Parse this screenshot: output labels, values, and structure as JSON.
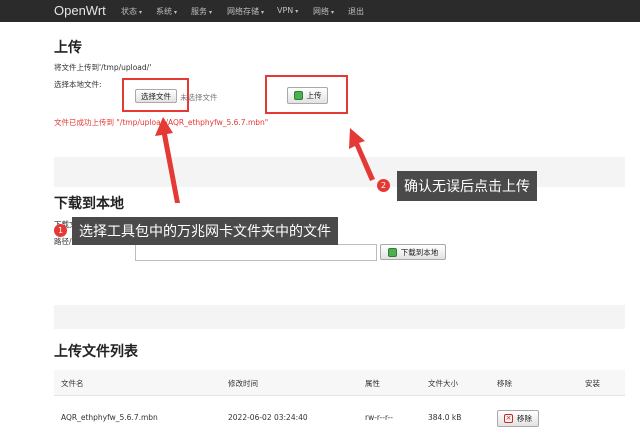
{
  "nav": {
    "brand": "OpenWrt",
    "items": [
      "状态",
      "系统",
      "服务",
      "网络存储",
      "VPN",
      "网络",
      "退出"
    ]
  },
  "upload": {
    "title": "上传",
    "desc": "将文件上传到'/tmp/upload/'",
    "choose_label": "选择本地文件:",
    "choose_button": "选择文件",
    "no_file": "未选择文件",
    "upload_button": "上传",
    "success_msg": "文件已成功上传到 \"/tmp/upload/AQR_ethphyfw_5.6.7.mbn\""
  },
  "download": {
    "title": "下载到本地",
    "file_label": "下载文件:",
    "path_label": "路径/文件:",
    "path_value": "",
    "download_button": "下载到本地"
  },
  "list": {
    "title": "上传文件列表",
    "headers": [
      "文件名",
      "修改时间",
      "属性",
      "文件大小",
      "移除",
      "安装"
    ],
    "rows": [
      {
        "name": "AQR_ethphyfw_5.6.7.mbn",
        "mtime": "2022-06-02 03:24:40",
        "attr": "rw-r--r--",
        "size": "384.0 kB",
        "remove": "移除"
      }
    ]
  },
  "callouts": {
    "one_num": "1",
    "one_text": "选择工具包中的万兆网卡文件夹中的文件",
    "two_num": "2",
    "two_text": "确认无误后点击上传"
  },
  "colors": {
    "navbar": "#2b2b2b",
    "highlight": "#e53935",
    "callout_bg": "#4a4a4a"
  }
}
